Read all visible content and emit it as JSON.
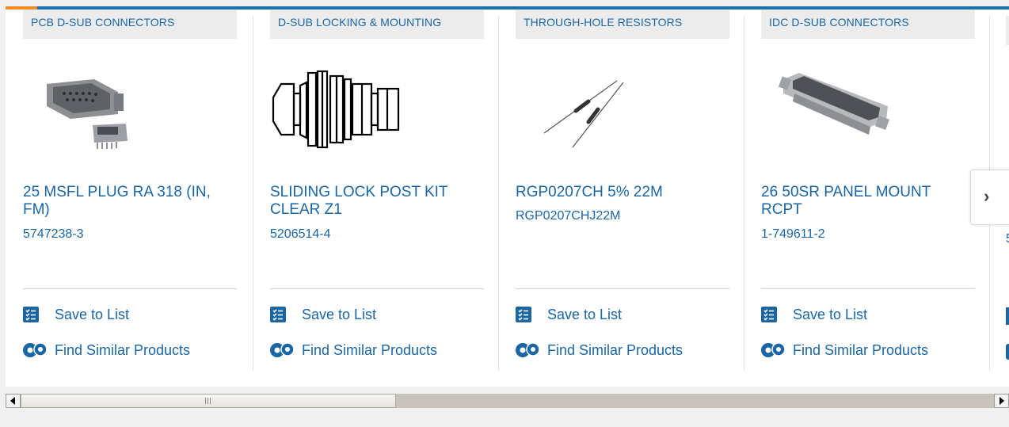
{
  "carousel": {
    "cards": [
      {
        "category": "PCB D-SUB CONNECTORS",
        "title": "25 MSFL PLUG RA 318 (IN, FM)",
        "part_number": "5747238-3",
        "image_icon": "dsub-connector-photo"
      },
      {
        "category": "D-SUB LOCKING & MOUNTING",
        "title": "SLIDING LOCK POST KIT CLEAR Z1",
        "part_number": "5206514-4",
        "image_icon": "lock-post-drawing"
      },
      {
        "category": "THROUGH-HOLE RESISTORS",
        "title": "RGP0207CH 5% 22M",
        "part_number": "RGP0207CHJ22M",
        "image_icon": "resistor-photo"
      },
      {
        "category": "IDC D-SUB CONNECTORS",
        "title": "26 50SR PANEL MOUNT RCPT",
        "part_number": "1-749611-2",
        "image_icon": "idc-connector-photo"
      }
    ],
    "actions": {
      "save_label": "Save to List",
      "similar_label": "Find Similar Products"
    },
    "next_button_label": "›",
    "partial_card_part_number": "5"
  },
  "colors": {
    "link": "#1a66a5",
    "top_bar": "#1a73ae",
    "top_accent": "#f28c28",
    "category_bg": "#ececec"
  },
  "scrollbar": {
    "position_fraction": 0.0
  }
}
